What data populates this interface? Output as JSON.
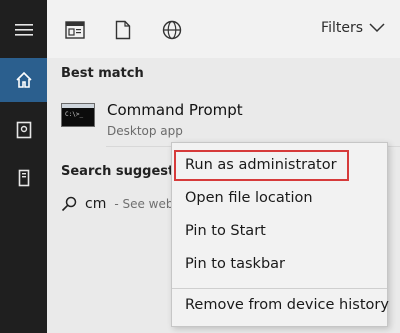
{
  "rail": {
    "icons": [
      "hamburger-icon",
      "home-icon",
      "document-icon",
      "tower-icon"
    ],
    "active_index": 1
  },
  "topbar": {
    "icons": [
      "app-window-icon",
      "document-icon",
      "globe-icon"
    ],
    "filters_label": "Filters"
  },
  "best_match": {
    "heading": "Best match",
    "title": "Command Prompt",
    "subtitle": "Desktop app",
    "thumb_text": "C:\\>_"
  },
  "suggestions": {
    "heading": "Search suggestion",
    "query": "cm",
    "hint": "- See web"
  },
  "context_menu": {
    "items": [
      "Run as administrator",
      "Open file location",
      "Pin to Start",
      "Pin to taskbar",
      "Remove from device history"
    ],
    "highlighted_index": 0,
    "highlight_color": "#d63a3a"
  },
  "colors": {
    "rail_bg": "#1f1f1f",
    "accent": "#2b5f8e"
  }
}
